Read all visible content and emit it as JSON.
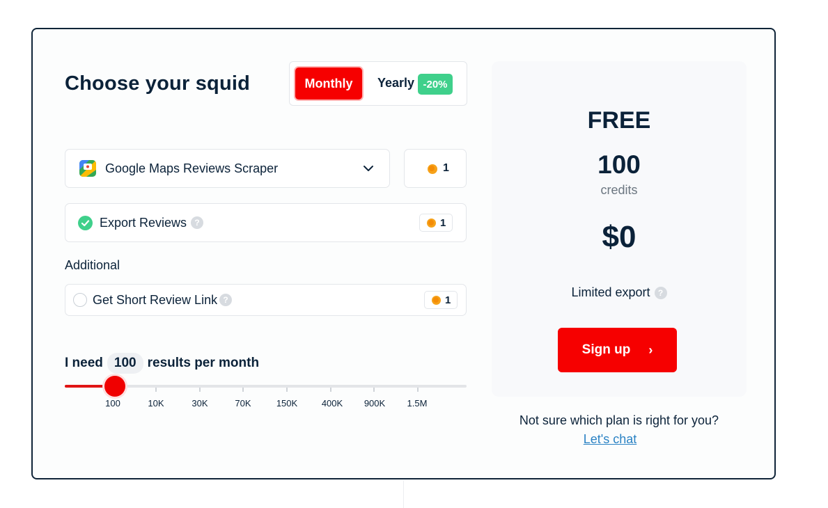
{
  "heading": "Choose your squid",
  "billing_toggle": {
    "monthly_label": "Monthly",
    "yearly_label": "Yearly",
    "yearly_discount": "-20%",
    "selected": "Monthly"
  },
  "scraper": {
    "selected": "Google Maps Reviews Scraper",
    "credits": "1"
  },
  "features": {
    "export_reviews": {
      "label": "Export Reviews",
      "credits": "1",
      "checked": true
    }
  },
  "additional": {
    "heading": "Additional",
    "items": [
      {
        "label": "Get Short Review Link",
        "credits": "1",
        "checked": false
      }
    ]
  },
  "volume": {
    "prefix": "I need",
    "value": "100",
    "suffix": "results per month",
    "slider_ticks": [
      "100",
      "10K",
      "30K",
      "70K",
      "150K",
      "400K",
      "900K",
      "1.5M"
    ],
    "selected_tick": "100"
  },
  "plan": {
    "tier": "FREE",
    "credits_amount": "100",
    "credits_unit": "credits",
    "price": "$0",
    "export_note": "Limited export",
    "cta_label": "Sign up",
    "cta_arrow": "›"
  },
  "help": {
    "question": "Not sure which plan is right for you?",
    "link_label": "Let's chat"
  },
  "icons": {
    "help": "?",
    "coin": "coin-icon",
    "check": "check-circle-icon",
    "chevron": "chevron-down-icon"
  },
  "colors": {
    "accent": "#f60000",
    "discount": "#3fd08b",
    "coin": "#f6a21a",
    "link": "#2a82c4",
    "text": "#0b2239"
  }
}
